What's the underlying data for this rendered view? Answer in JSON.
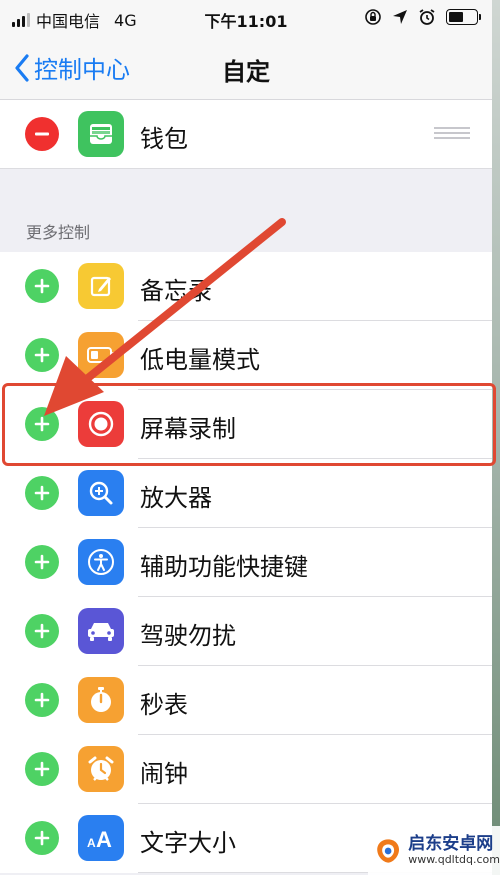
{
  "status_bar": {
    "carrier": "中国电信",
    "network": "4G",
    "time": "下午11:01",
    "icons": [
      "orientation-lock-icon",
      "location-icon",
      "alarm-icon",
      "battery-icon"
    ]
  },
  "nav": {
    "back_label": "控制中心",
    "title": "自定"
  },
  "included_controls": [
    {
      "label": "钱包",
      "icon": "wallet-icon",
      "color": "#3fc35f"
    }
  ],
  "more_controls_header": "更多控制",
  "more_controls": [
    {
      "label": "备忘录",
      "icon": "notes-icon",
      "color": "#f7c933"
    },
    {
      "label": "低电量模式",
      "icon": "low-power-icon",
      "color": "#f6a132"
    },
    {
      "label": "屏幕录制",
      "icon": "screen-record-icon",
      "color": "#ec3c3a"
    },
    {
      "label": "放大器",
      "icon": "magnifier-icon",
      "color": "#2a7ff0"
    },
    {
      "label": "辅助功能快捷键",
      "icon": "accessibility-icon",
      "color": "#2a7ff0"
    },
    {
      "label": "驾驶勿扰",
      "icon": "car-icon",
      "color": "#5a56d6"
    },
    {
      "label": "秒表",
      "icon": "stopwatch-icon",
      "color": "#f6a132"
    },
    {
      "label": "闹钟",
      "icon": "alarm-clock-icon",
      "color": "#f6a132"
    },
    {
      "label": "文字大小",
      "icon": "text-size-icon",
      "color": "#2a7ff0"
    }
  ],
  "colors": {
    "accent": "#1a7cf3",
    "add": "#4ed264",
    "remove": "#f0302f",
    "annotation": "#e04832"
  },
  "watermark": {
    "title": "启东安卓网",
    "url": "www.qdltdq.com"
  }
}
